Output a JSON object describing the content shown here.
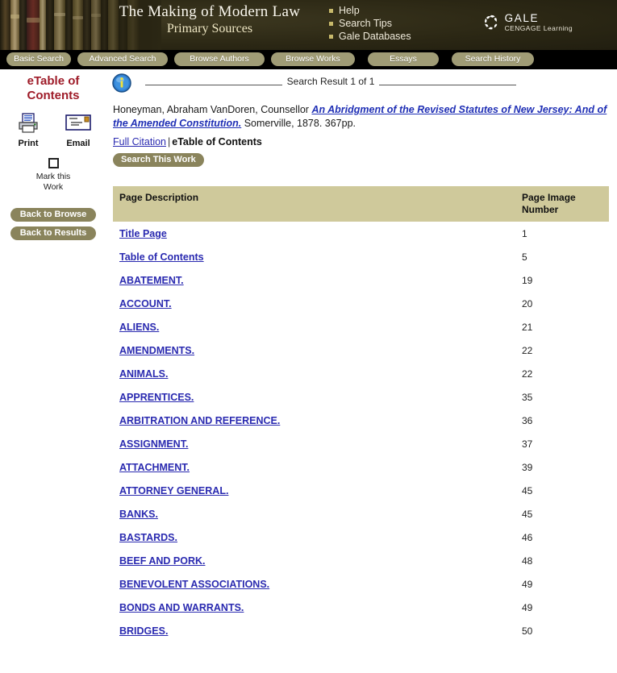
{
  "masthead": {
    "title_line1": "The Making of Modern Law",
    "title_line2": "Primary Sources",
    "help_links": [
      {
        "label": "Help"
      },
      {
        "label": "Search Tips"
      },
      {
        "label": "Gale Databases"
      }
    ],
    "logo": {
      "name": "GALE",
      "tagline": "CENGAGE Learning"
    },
    "colors": {
      "masthead_bg": "#2b2714",
      "nav_bg": "#000000",
      "pill": "#a09c76",
      "table_header": "#cfc99b",
      "heading_red": "#9e1b28",
      "link_blue": "#2a2ab0"
    }
  },
  "nav": {
    "items": [
      {
        "label": "Basic Search"
      },
      {
        "label": "Advanced Search"
      },
      {
        "label": "Browse Authors"
      },
      {
        "label": "Browse Works"
      },
      {
        "label": "Essays"
      },
      {
        "label": "Search History"
      }
    ]
  },
  "sidebar": {
    "heading": "eTable of Contents",
    "print_label": "Print",
    "email_label": "Email",
    "mark_label_line1": "Mark this",
    "mark_label_line2": "Work",
    "back_to_browse": "Back to Browse",
    "back_to_results": "Back to Results"
  },
  "main": {
    "result_label": "Search Result 1 of 1",
    "citation_author": "Honeyman, Abraham VanDoren, Counsellor",
    "citation_title": "An Abridgment of the Revised Statutes of New Jersey: And of the Amended Constitution.",
    "citation_imprint": " Somerville, 1878. 367pp.",
    "full_citation_link": "Full Citation",
    "separator": "|",
    "current_view": "eTable of Contents",
    "search_this_work": "Search This Work"
  },
  "table": {
    "headers": {
      "description": "Page Description",
      "number_line1": "Page Image",
      "number_line2": "Number"
    },
    "rows": [
      {
        "description": "Title Page",
        "page": "1"
      },
      {
        "description": "Table of Contents",
        "page": "5"
      },
      {
        "description": "ABATEMENT.",
        "page": "19"
      },
      {
        "description": "ACCOUNT.",
        "page": "20"
      },
      {
        "description": "ALIENS.",
        "page": "21"
      },
      {
        "description": "AMENDMENTS.",
        "page": "22"
      },
      {
        "description": "ANIMALS.",
        "page": "22"
      },
      {
        "description": "APPRENTICES.",
        "page": "35"
      },
      {
        "description": "ARBITRATION AND REFERENCE.",
        "page": "36"
      },
      {
        "description": "ASSIGNMENT.",
        "page": "37"
      },
      {
        "description": "ATTACHMENT.",
        "page": "39"
      },
      {
        "description": "ATTORNEY GENERAL.",
        "page": "45"
      },
      {
        "description": "BANKS.",
        "page": "45"
      },
      {
        "description": "BASTARDS.",
        "page": "46"
      },
      {
        "description": "BEEF AND PORK.",
        "page": "48"
      },
      {
        "description": "BENEVOLENT ASSOCIATIONS.",
        "page": "49"
      },
      {
        "description": "BONDS AND WARRANTS.",
        "page": "49"
      },
      {
        "description": "BRIDGES.",
        "page": "50"
      }
    ]
  }
}
